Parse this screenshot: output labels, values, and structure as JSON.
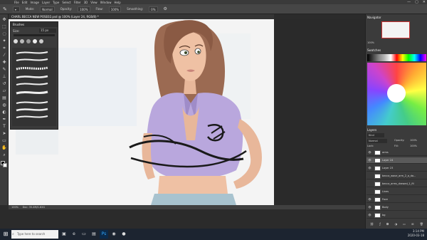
{
  "app": {
    "menus": [
      "File",
      "Edit",
      "Image",
      "Layer",
      "Type",
      "Select",
      "Filter",
      "3D",
      "View",
      "Window",
      "Help"
    ],
    "window_controls": [
      "—",
      "▢",
      "✕"
    ]
  },
  "options_bar": {
    "mode_label": "Mode:",
    "mode_value": "Normal",
    "opacity_label": "Opacity:",
    "opacity_value": "100%",
    "flow_label": "Flow:",
    "flow_value": "100%",
    "smoothing_label": "Smoothing:",
    "smoothing_value": "0%"
  },
  "document": {
    "tab_title": "CHARL BECCA NEW POSE02.psd @ 100% (Layer 24, RGB/8) *"
  },
  "brushes_panel": {
    "title": "Brushes",
    "size_label": "Size:",
    "size_value": "15 px"
  },
  "right_panels": {
    "navigator_title": "Navigator",
    "zoom_value": "100%",
    "swatches_title": "Swatches",
    "layers_title": "Layers",
    "layer_kind": "Kind",
    "blend_mode": "Normal",
    "opacity_label": "Opacity:",
    "opacity_value": "100%",
    "lock_label": "Lock:",
    "fill_label": "Fill:",
    "fill_value": "100%",
    "layers": [
      {
        "name": "arms",
        "visible": true,
        "selected": false
      },
      {
        "name": "Layer 24",
        "visible": true,
        "selected": true
      },
      {
        "name": "Layer 23",
        "visible": true,
        "selected": false
      },
      {
        "name": "becca_wave_arm_2_a_da...",
        "visible": false,
        "selected": false
      },
      {
        "name": "becca_arms_drawed_1_fil",
        "visible": false,
        "selected": false
      },
      {
        "name": "Lines",
        "visible": false,
        "selected": false
      },
      {
        "name": "Face",
        "visible": true,
        "selected": false
      },
      {
        "name": "Body",
        "visible": true,
        "selected": false
      },
      {
        "name": "bg",
        "visible": true,
        "selected": false
      }
    ]
  },
  "status_bar": {
    "zoom": "100%",
    "doc_size": "Doc: 35.4M/1.82G"
  },
  "taskbar": {
    "search_placeholder": "Type here to search",
    "time": "3:14 PM",
    "date": "2020-03-18"
  },
  "colors": {
    "shirt": "#b9a7dd",
    "hair": "#8a5a44",
    "skin": "#e8b79a",
    "jeans": "#a8c3cf",
    "stroke": "#1a1a1a"
  }
}
